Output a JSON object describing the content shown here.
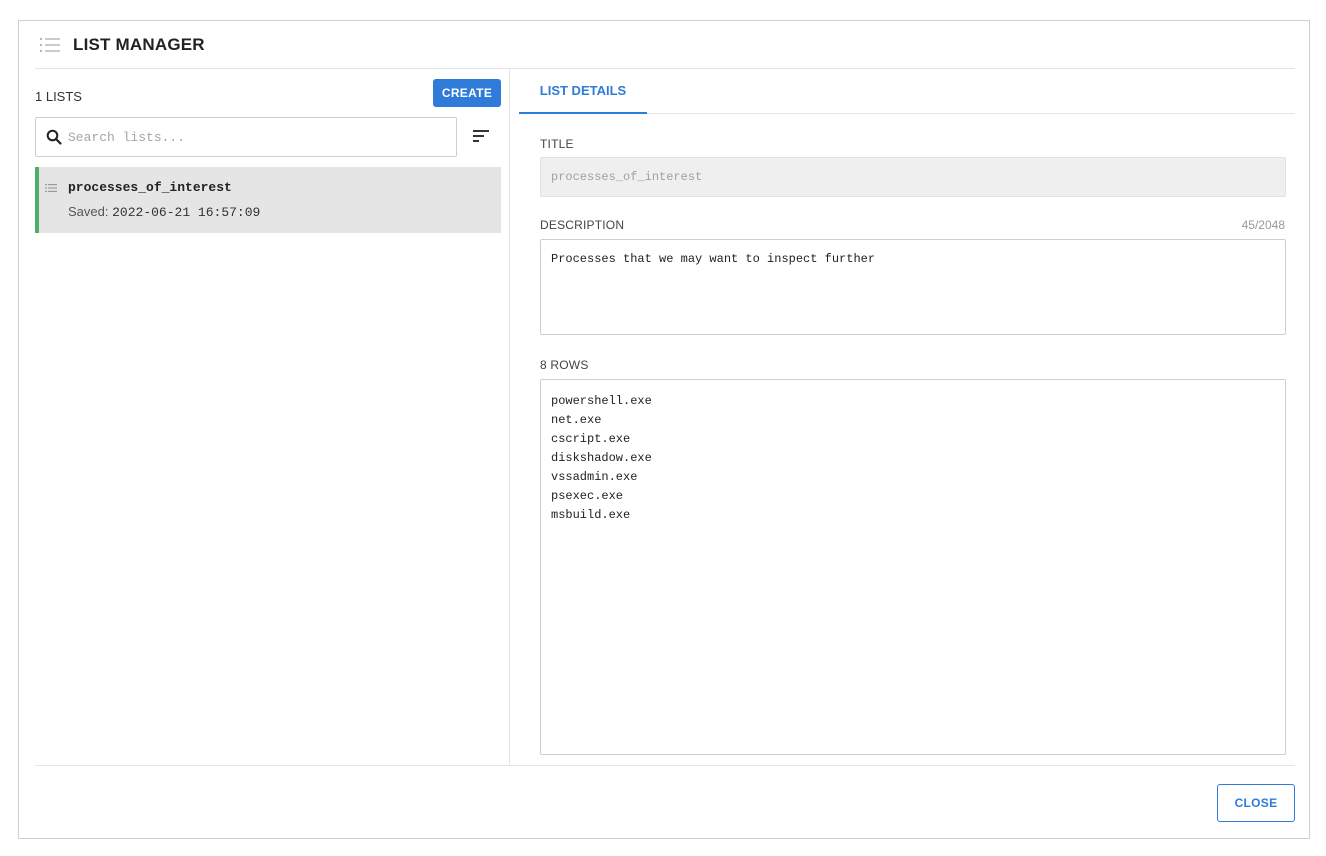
{
  "header": {
    "title": "LIST MANAGER",
    "icon": "list-icon"
  },
  "left": {
    "lists_count": "1 LISTS",
    "create_label": "CREATE",
    "search": {
      "placeholder": "Search lists...",
      "value": ""
    },
    "items": [
      {
        "name": "processes_of_interest",
        "saved_label": "Saved:",
        "saved_time": "2022-06-21 16:57:09",
        "selected": true
      }
    ]
  },
  "right": {
    "tab_label": "LIST DETAILS",
    "title_label": "TITLE",
    "title_value": "processes_of_interest",
    "description_label": "DESCRIPTION",
    "description_counter": "45/2048",
    "description_value": "Processes that we may want to inspect further",
    "rows_label": "8 ROWS",
    "rows_value": "powershell.exe\nnet.exe\ncscript.exe\ndiskshadow.exe\nvssadmin.exe\npsexec.exe\nmsbuild.exe"
  },
  "footer": {
    "close_label": "CLOSE"
  },
  "colors": {
    "accent": "#2f7bd9",
    "selected_bar": "#4caf6a",
    "selected_bg": "#e5e5e5"
  }
}
